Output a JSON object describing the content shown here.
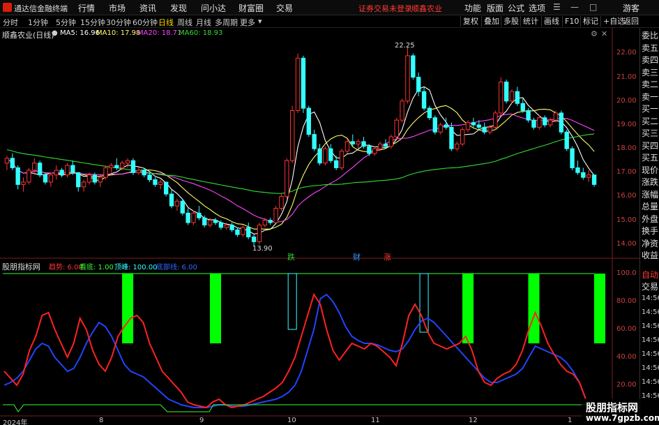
{
  "app": {
    "name": "通达信金融终端",
    "menus": [
      "行情",
      "市场",
      "资讯",
      "发现",
      "问小达",
      "财富圈",
      "交易"
    ],
    "warning": "证券交易未登录",
    "stock_name_top": "顺鑫农业",
    "right_menus": [
      "功能",
      "版面",
      "公式",
      "选项"
    ],
    "guest": "游客"
  },
  "periods": [
    "分时",
    "1分钟",
    "5分钟",
    "15分钟",
    "30分钟",
    "60分钟",
    "日线",
    "周线",
    "月线",
    "多周期",
    "更多"
  ],
  "active_period": "日线",
  "toolbar": [
    "复权",
    "叠加",
    "多股",
    "统计",
    "画线",
    "F10",
    "标记",
    "+自选",
    "返回"
  ],
  "sidebar": {
    "items": [
      "委比",
      "卖五",
      "卖四",
      "卖三",
      "卖二",
      "卖一",
      "买一",
      "买二",
      "买三",
      "买四",
      "买五",
      "现价",
      "涨跌",
      "涨幅",
      "总量",
      "外盘",
      "换手",
      "净资",
      "收益"
    ],
    "lower": [
      "自动",
      "交易"
    ],
    "times": [
      "14:56",
      "14:56",
      "14:56",
      "14:56",
      "14:56",
      "14:56",
      "14:56",
      "14:56"
    ]
  },
  "main_chart": {
    "title": "顺鑫农业(日线)",
    "ma": [
      {
        "label": "MA5: 16.96",
        "color": "#ffffff"
      },
      {
        "label": "MA10: 17.98",
        "color": "#ffff66"
      },
      {
        "label": "MA20: 18.71",
        "color": "#ff44ff"
      },
      {
        "label": "MA60: 18.93",
        "color": "#33dd33"
      }
    ],
    "y_ticks": [
      "22.00",
      "21.00",
      "20.00",
      "19.00",
      "18.00",
      "17.00",
      "16.00",
      "15.00",
      "14.00"
    ],
    "high_label": "22.25",
    "low_label": "13.90",
    "event_marks": [
      {
        "text": "跌",
        "color": "#33cc33"
      },
      {
        "text": "财",
        "color": "#3399ff"
      },
      {
        "text": "涨",
        "color": "#ff3333"
      }
    ]
  },
  "indicator": {
    "title": "股朋指标网",
    "params": [
      {
        "label": "趋势: 6.00",
        "color": "#ff3333"
      },
      {
        "label": "看底: 1.00",
        "color": "#33ff33"
      },
      {
        "label": "顶峰: 100.00",
        "color": "#33ffff"
      },
      {
        "label": "底部线: 6.00",
        "color": "#3366ff"
      }
    ],
    "y_ticks": [
      "100.0",
      "80.00",
      "60.00",
      "40.00",
      "20.00"
    ]
  },
  "x_axis": [
    "2024年",
    "8",
    "9",
    "10",
    "11",
    "12",
    "1"
  ],
  "watermark": {
    "line1": "股朋指标网",
    "line2": "www.7gpzb.com"
  },
  "colors": {
    "up": "#ff3333",
    "down": "#33ffff",
    "green_bar": "#00ff00"
  },
  "chart_data": {
    "type": "candlestick",
    "y_range": [
      13.7,
      22.6
    ],
    "indicator_range": [
      0,
      100
    ],
    "candles": [
      [
        17.4,
        17.7,
        17.1,
        17.6
      ],
      [
        17.6,
        17.8,
        17.1,
        17.2
      ],
      [
        17.2,
        17.3,
        16.3,
        16.5
      ],
      [
        16.5,
        16.8,
        16.2,
        16.6
      ],
      [
        16.6,
        17.2,
        16.5,
        17.1
      ],
      [
        17.1,
        17.6,
        16.9,
        17.4
      ],
      [
        17.4,
        17.5,
        16.8,
        16.9
      ],
      [
        16.9,
        17.0,
        16.5,
        16.6
      ],
      [
        16.6,
        17.0,
        16.4,
        16.9
      ],
      [
        16.9,
        17.3,
        16.7,
        17.1
      ],
      [
        17.1,
        17.2,
        16.8,
        16.9
      ],
      [
        16.9,
        17.4,
        16.8,
        17.3
      ],
      [
        17.3,
        17.5,
        16.9,
        17.0
      ],
      [
        17.0,
        17.0,
        16.2,
        16.4
      ],
      [
        16.4,
        16.7,
        16.2,
        16.6
      ],
      [
        16.6,
        17.0,
        16.5,
        16.9
      ],
      [
        16.9,
        17.0,
        16.5,
        16.6
      ],
      [
        16.6,
        16.9,
        16.4,
        16.8
      ],
      [
        16.8,
        17.3,
        16.7,
        17.2
      ],
      [
        17.2,
        17.4,
        17.0,
        17.3
      ],
      [
        17.3,
        17.6,
        17.1,
        17.2
      ],
      [
        17.2,
        17.5,
        17.1,
        17.4
      ],
      [
        17.4,
        17.6,
        17.2,
        17.5
      ],
      [
        17.5,
        17.6,
        16.9,
        17.0
      ],
      [
        17.0,
        17.2,
        16.9,
        17.1
      ],
      [
        17.1,
        17.2,
        16.8,
        16.9
      ],
      [
        16.9,
        17.0,
        16.6,
        16.7
      ],
      [
        16.7,
        16.8,
        16.4,
        16.5
      ],
      [
        16.5,
        16.7,
        16.3,
        16.6
      ],
      [
        16.6,
        16.6,
        16.0,
        16.1
      ],
      [
        16.1,
        16.3,
        15.5,
        15.6
      ],
      [
        15.6,
        15.9,
        15.4,
        15.8
      ],
      [
        15.8,
        15.9,
        15.2,
        15.3
      ],
      [
        15.3,
        15.5,
        14.8,
        14.9
      ],
      [
        14.9,
        15.4,
        14.8,
        15.3
      ],
      [
        15.3,
        15.6,
        15.0,
        15.1
      ],
      [
        15.1,
        15.2,
        14.7,
        14.8
      ],
      [
        14.8,
        15.1,
        14.7,
        15.0
      ],
      [
        15.0,
        15.1,
        14.8,
        14.9
      ],
      [
        14.9,
        15.0,
        14.6,
        14.7
      ],
      [
        14.7,
        14.9,
        14.6,
        14.8
      ],
      [
        14.8,
        14.9,
        14.5,
        14.6
      ],
      [
        14.6,
        14.7,
        14.3,
        14.4
      ],
      [
        14.4,
        14.8,
        14.3,
        14.7
      ],
      [
        14.7,
        14.9,
        14.2,
        14.3
      ],
      [
        14.3,
        14.4,
        13.9,
        14.1
      ],
      [
        14.1,
        14.9,
        14.0,
        14.8
      ],
      [
        14.8,
        15.1,
        14.7,
        15.0
      ],
      [
        15.0,
        15.1,
        14.8,
        14.9
      ],
      [
        14.9,
        15.6,
        14.9,
        15.5
      ],
      [
        15.5,
        16.1,
        15.4,
        16.0
      ],
      [
        16.0,
        17.6,
        15.9,
        17.5
      ],
      [
        17.5,
        19.8,
        17.4,
        19.6
      ],
      [
        19.6,
        22.0,
        19.5,
        21.8
      ],
      [
        21.8,
        21.9,
        19.5,
        19.7
      ],
      [
        19.7,
        19.8,
        18.5,
        18.6
      ],
      [
        18.6,
        18.8,
        17.9,
        18.0
      ],
      [
        18.0,
        18.2,
        17.3,
        17.4
      ],
      [
        17.4,
        18.1,
        17.3,
        18.0
      ],
      [
        18.0,
        18.2,
        17.4,
        17.5
      ],
      [
        17.5,
        17.7,
        17.1,
        17.2
      ],
      [
        17.2,
        18.0,
        17.1,
        17.9
      ],
      [
        17.9,
        18.4,
        17.8,
        18.3
      ],
      [
        18.3,
        18.6,
        18.1,
        18.2
      ],
      [
        18.2,
        18.4,
        18.0,
        18.3
      ],
      [
        18.3,
        18.5,
        18.0,
        18.1
      ],
      [
        18.1,
        18.2,
        17.7,
        17.8
      ],
      [
        17.8,
        18.1,
        17.7,
        18.0
      ],
      [
        18.0,
        18.3,
        17.9,
        18.2
      ],
      [
        18.2,
        18.4,
        18.0,
        18.1
      ],
      [
        18.1,
        18.6,
        18.0,
        18.5
      ],
      [
        18.5,
        19.3,
        18.4,
        19.2
      ],
      [
        19.2,
        20.1,
        19.1,
        20.0
      ],
      [
        20.0,
        22.25,
        19.9,
        21.9
      ],
      [
        21.9,
        22.0,
        20.9,
        21.0
      ],
      [
        21.0,
        21.2,
        20.2,
        20.4
      ],
      [
        20.4,
        20.6,
        19.6,
        19.7
      ],
      [
        19.7,
        19.8,
        19.2,
        19.3
      ],
      [
        19.3,
        19.4,
        18.6,
        18.7
      ],
      [
        18.7,
        19.1,
        18.6,
        19.0
      ],
      [
        19.0,
        19.3,
        18.8,
        18.9
      ],
      [
        18.9,
        19.1,
        17.9,
        18.0
      ],
      [
        18.0,
        18.3,
        17.9,
        18.2
      ],
      [
        18.2,
        18.9,
        18.1,
        18.8
      ],
      [
        18.8,
        19.2,
        18.7,
        19.1
      ],
      [
        19.1,
        19.3,
        18.9,
        19.0
      ],
      [
        19.0,
        19.2,
        18.8,
        18.9
      ],
      [
        18.9,
        19.1,
        18.6,
        18.7
      ],
      [
        18.7,
        19.0,
        18.6,
        18.9
      ],
      [
        18.9,
        19.6,
        18.8,
        19.5
      ],
      [
        19.5,
        21.0,
        19.4,
        20.8
      ],
      [
        20.8,
        20.9,
        19.9,
        20.0
      ],
      [
        20.0,
        20.5,
        19.9,
        20.4
      ],
      [
        20.4,
        20.6,
        19.8,
        19.9
      ],
      [
        19.9,
        20.1,
        19.5,
        19.6
      ],
      [
        19.6,
        19.7,
        19.1,
        19.2
      ],
      [
        19.2,
        19.3,
        18.8,
        18.9
      ],
      [
        18.9,
        19.4,
        18.8,
        19.3
      ],
      [
        19.3,
        19.4,
        18.9,
        19.0
      ],
      [
        19.0,
        19.3,
        18.9,
        19.2
      ],
      [
        19.2,
        19.6,
        19.1,
        19.5
      ],
      [
        19.5,
        19.6,
        18.6,
        18.7
      ],
      [
        18.7,
        18.8,
        17.9,
        18.0
      ],
      [
        18.0,
        18.1,
        17.1,
        17.2
      ],
      [
        17.2,
        17.5,
        16.9,
        17.0
      ],
      [
        17.0,
        17.2,
        16.7,
        16.8
      ],
      [
        16.8,
        17.1,
        16.6,
        16.9
      ],
      [
        16.9,
        16.9,
        16.4,
        16.5
      ]
    ],
    "trend_line": [
      30,
      25,
      20,
      28,
      45,
      55,
      70,
      72,
      60,
      50,
      40,
      50,
      68,
      60,
      45,
      35,
      30,
      40,
      55,
      62,
      68,
      70,
      65,
      50,
      40,
      30,
      25,
      20,
      15,
      8,
      6,
      5,
      4,
      8,
      10,
      6,
      4,
      5,
      6,
      8,
      10,
      12,
      15,
      18,
      22,
      30,
      40,
      55,
      70,
      85,
      78,
      60,
      45,
      38,
      44,
      50,
      48,
      46,
      50,
      48,
      44,
      40,
      34,
      50,
      70,
      78,
      70,
      58,
      50,
      48,
      46,
      48,
      50,
      55,
      45,
      30,
      22,
      20,
      25,
      28,
      30,
      35,
      45,
      60,
      72,
      62,
      50,
      42,
      35,
      30,
      28,
      22,
      10
    ],
    "bottom_line": [
      20,
      22,
      25,
      30,
      38,
      46,
      50,
      48,
      40,
      35,
      30,
      32,
      40,
      50,
      58,
      65,
      62,
      55,
      45,
      35,
      30,
      28,
      26,
      22,
      18,
      14,
      10,
      8,
      6,
      5,
      4,
      4,
      4,
      5,
      6,
      6,
      5,
      5,
      5,
      6,
      7,
      8,
      9,
      10,
      12,
      15,
      20,
      30,
      45,
      60,
      82,
      85,
      80,
      72,
      62,
      55,
      52,
      50,
      50,
      49,
      47,
      45,
      44,
      46,
      52,
      60,
      66,
      68,
      65,
      60,
      55,
      50,
      45,
      40,
      35,
      30,
      25,
      22,
      22,
      24,
      26,
      28,
      32,
      40,
      48,
      46,
      44,
      42,
      40,
      36,
      30,
      22,
      10
    ],
    "green_bars": [
      {
        "from_pct": 50,
        "to_pct": 100
      },
      {
        "from_pct": 50,
        "to_pct": 100
      },
      {
        "from_pct": 50,
        "to_pct": 100
      },
      {
        "from_pct": 50,
        "to_pct": 100
      },
      {
        "from_pct": 50,
        "to_pct": 100
      },
      {
        "from_pct": 50,
        "to_pct": 100
      },
      {
        "from_pct": 50,
        "to_pct": 100
      },
      {
        "from_pct": 50,
        "to_pct": 100
      },
      {
        "from_pct": 50,
        "to_pct": 100
      }
    ],
    "peak_boxes": [
      {
        "from_pct": 60,
        "to_pct": 100
      },
      {
        "from_pct": 58,
        "to_pct": 100
      }
    ]
  }
}
